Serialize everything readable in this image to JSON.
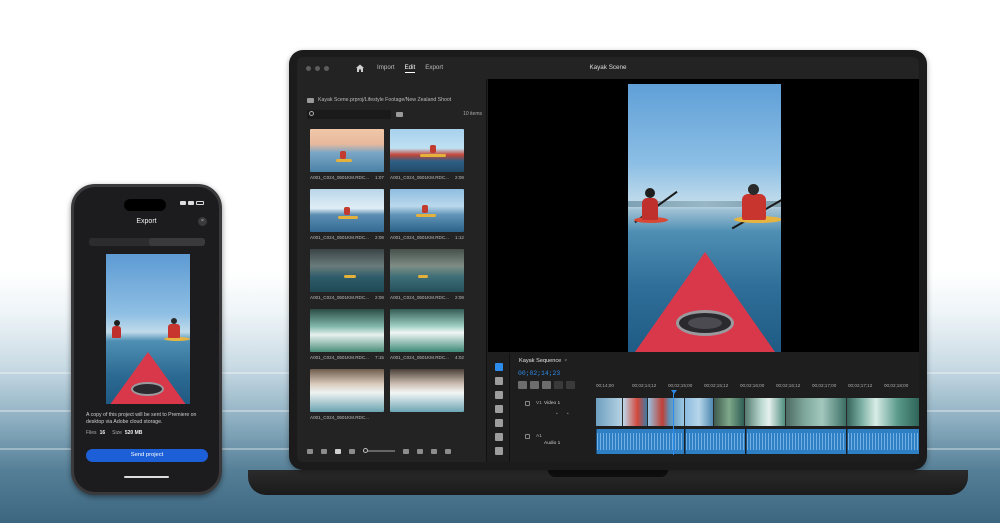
{
  "laptop": {
    "title": "Kayak Scene",
    "menu": {
      "import": "Import",
      "edit": "Edit",
      "export": "Export"
    },
    "project": {
      "path": "Kayak Scene.prproj/Lifestyle Footage/New Zealand Shoot",
      "items_count": "10 items",
      "clips": [
        {
          "name": "A001_C024_0501KM.RDC...",
          "duration": "1:07"
        },
        {
          "name": "A001_C024_0501KM.RDC...",
          "duration": "2:08"
        },
        {
          "name": "A001_C024_0501KM.RDC...",
          "duration": "2:08"
        },
        {
          "name": "A001_C024_0501KM.RDC...",
          "duration": "1:12"
        },
        {
          "name": "A001_C024_0501KM.RDC...",
          "duration": "2:08"
        },
        {
          "name": "A001_C024_0501KM.RDC...",
          "duration": "2:08"
        },
        {
          "name": "A001_C024_0501KM.RDC...",
          "duration": "7:15"
        },
        {
          "name": "A001_C024_0501KM.RDC...",
          "duration": "4:02"
        },
        {
          "name": "A001_C024_0501KM.RDC...",
          "duration": ""
        },
        {
          "name": "",
          "duration": ""
        }
      ]
    },
    "sequence": {
      "name": "Kayak Sequence",
      "timecode": "00;02;14;23",
      "ruler": [
        "00;14;00",
        "00;02;14;12",
        "00;02;15;00",
        "00;02;15;12",
        "00;02;16;00",
        "00;02;16;12",
        "00;02;17;00",
        "00;02;17;12",
        "00;02;18;00"
      ],
      "video_track": {
        "id": "V1",
        "name": "Video 1"
      },
      "audio_track": {
        "id": "A1",
        "name": "Audio 1"
      }
    }
  },
  "phone": {
    "title": "Export",
    "close": "×",
    "description": "A copy of this project will be sent to Premiere on desktop via Adobe cloud storage.",
    "files_label": "Files",
    "files_value": "16",
    "size_label": "Size",
    "size_value": "520 MB",
    "send_button": "Send project"
  },
  "icons": [
    "home-icon",
    "folder-icon",
    "search-icon",
    "bin-icon",
    "selection-tool-icon",
    "ripple-edit-icon",
    "razor-icon",
    "slip-icon",
    "pen-icon",
    "hand-icon",
    "lock-icon",
    "close-icon"
  ],
  "colors": {
    "accent": "#2d8ceb",
    "send_button": "#1c5fd6",
    "kayak_red": "#d9384a"
  }
}
